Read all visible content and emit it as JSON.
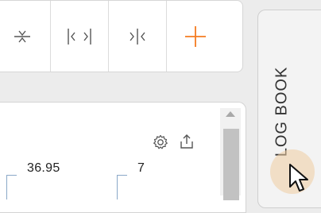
{
  "toolbar": {
    "tools": [
      {
        "icon": "collapse-vertical-icon"
      },
      {
        "icon": "expand-horizontal-icon"
      },
      {
        "icon": "collapse-horizontal-icon"
      },
      {
        "icon": "crosshair-icon",
        "color": "#f47b20"
      }
    ]
  },
  "side_panel": {
    "label": "LOG BOOK"
  },
  "card": {
    "values": [
      "36.95",
      "7"
    ]
  },
  "colors": {
    "accent": "#f47b20",
    "icon": "#555555",
    "bracket": "#8aa8c8"
  }
}
